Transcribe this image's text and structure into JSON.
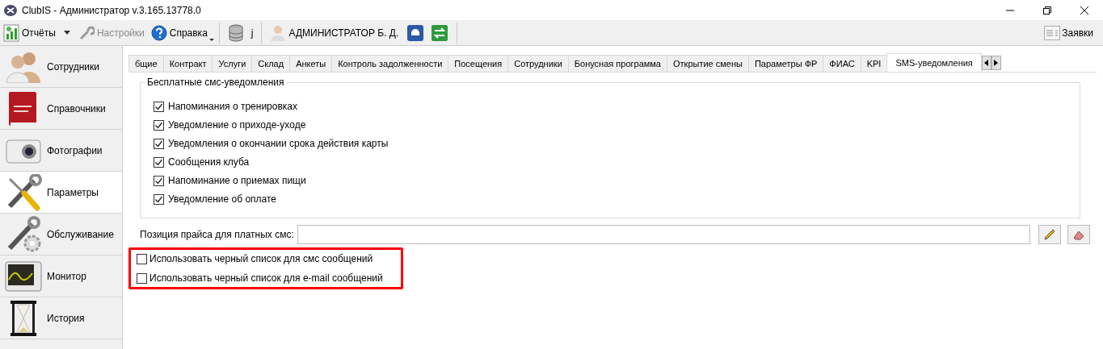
{
  "window": {
    "title": "ClubIS - Администратор v.3.165.13778.0"
  },
  "toolbar": {
    "items": [
      {
        "kind": "reports",
        "label": "Отчёты",
        "disabled": false
      },
      {
        "kind": "settings",
        "label": "Настройки",
        "disabled": true
      },
      {
        "kind": "help",
        "label": "Справка",
        "disabled": false
      },
      {
        "kind": "database",
        "label": "j",
        "disabled": false
      },
      {
        "kind": "user",
        "label": "АДМИНИСТРАТОР Б. Д.",
        "disabled": false
      }
    ],
    "requests": {
      "label": "Заявки"
    }
  },
  "sidebar": {
    "items": [
      {
        "kind": "people",
        "label": "Сотрудники",
        "selected": false
      },
      {
        "kind": "book",
        "label": "Справочники",
        "selected": false
      },
      {
        "kind": "camera",
        "label": "Фотографии",
        "selected": false
      },
      {
        "kind": "tools",
        "label": "Параметры",
        "selected": true
      },
      {
        "kind": "service",
        "label": "Обслуживание",
        "selected": false
      },
      {
        "kind": "monitor",
        "label": "Монитор",
        "selected": false
      },
      {
        "kind": "history",
        "label": "История",
        "selected": false
      }
    ]
  },
  "tabs": [
    {
      "label": "бщие",
      "selected": false
    },
    {
      "label": "Контракт",
      "selected": false
    },
    {
      "label": "Услуги",
      "selected": false
    },
    {
      "label": "Склад",
      "selected": false
    },
    {
      "label": "Анкеты",
      "selected": false
    },
    {
      "label": "Контроль задолженности",
      "selected": false
    },
    {
      "label": "Посещения",
      "selected": false
    },
    {
      "label": "Сотрудники",
      "selected": false
    },
    {
      "label": "Бонусная программа",
      "selected": false
    },
    {
      "label": "Открытие смены",
      "selected": false
    },
    {
      "label": "Параметры ФР",
      "selected": false
    },
    {
      "label": "ФИАС",
      "selected": false
    },
    {
      "label": "KPI",
      "selected": false
    },
    {
      "label": "SMS-уведомления",
      "selected": true
    }
  ],
  "free_sms": {
    "title": "Бесплатные смс-уведомления",
    "options": [
      {
        "label": "Напоминания о тренировках",
        "checked": true
      },
      {
        "label": "Уведомление о приходе-уходе",
        "checked": true
      },
      {
        "label": "Уведомления о окончании срока действия карты",
        "checked": true
      },
      {
        "label": "Сообщения клуба",
        "checked": true
      },
      {
        "label": "Напоминание о приемах пищи",
        "checked": true
      },
      {
        "label": "Уведомление об оплате",
        "checked": true
      }
    ]
  },
  "price_position": {
    "label": "Позиция прайса для платных смс:"
  },
  "blacklist": [
    {
      "label": "Использовать черный список для смс сообщений",
      "checked": false
    },
    {
      "label": "Использовать черный список для e-mail сообщений",
      "checked": false
    }
  ]
}
